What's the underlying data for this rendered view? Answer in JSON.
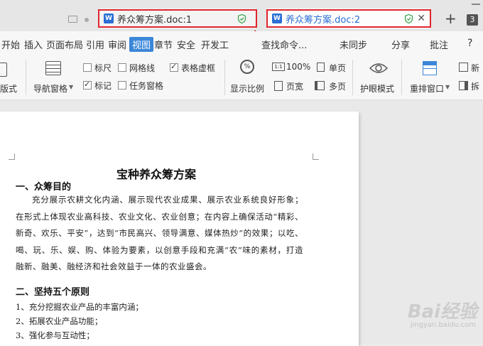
{
  "tabs": [
    {
      "label": "养众筹方案.doc:1",
      "icon": "W"
    },
    {
      "label": "养众筹方案.doc:2",
      "icon": "W"
    }
  ],
  "tabbar": {
    "new_tab": "+",
    "tab_count": "3"
  },
  "menu": {
    "items": [
      "开始",
      "插入",
      "页面布局",
      "引用",
      "审阅",
      "视图",
      "章节",
      "安全",
      "开发工"
    ],
    "active": "视图",
    "search": "查找命令...",
    "sync": "未同步",
    "share": "分享",
    "annotate": "批注",
    "help": "?"
  },
  "ribbon": {
    "layout_mode": "版式",
    "nav_pane": "导航窗格",
    "ruler": "标尺",
    "gridlines": "网格线",
    "table_gridlines": "表格虚框",
    "markers": "标记",
    "task_pane": "任务窗格",
    "zoom_ratio": "显示比例",
    "zoom_100": "100%",
    "single_page": "单页",
    "page_width": "页宽",
    "multi_page": "多页",
    "eye_mode": "护眼模式",
    "rearrange": "重排窗口",
    "new_window": "新",
    "split_window": "拆"
  },
  "checkbox_states": {
    "ruler": false,
    "gridlines": false,
    "table_gridlines": true,
    "markers": true,
    "task_pane": false
  },
  "document": {
    "title": "宝种养众筹方案",
    "h1": "一、众筹目的",
    "p1": "充分展示农耕文化内涵、展示现代农业成果、展示农业系统良好形象；在形式上体现农业高科技、农业文化、农业创意；在内容上确保活动“精彩、新奇、欢乐、平安”，达到“市民高兴、领导满意、媒体热炒”的效果；以吃、喝、玩、乐、娱、购、体验为要素，以创意手段和充满“农”味的素材，打造融新、融美、融经济和社会效益于一体的农业盛会。",
    "h2": "二、坚持五个原则",
    "li1": "1、充分挖掘农业产品的丰富内涵；",
    "li2": "2、拓展农业产品功能；",
    "li3": "3、强化参与互动性；"
  },
  "watermark": {
    "brand": "Bai经验",
    "url": "jingyan.baidu.com"
  },
  "colors": {
    "highlight": "#e0262f",
    "accent": "#3b86d8",
    "doc_icon": "#2b6fd6"
  }
}
